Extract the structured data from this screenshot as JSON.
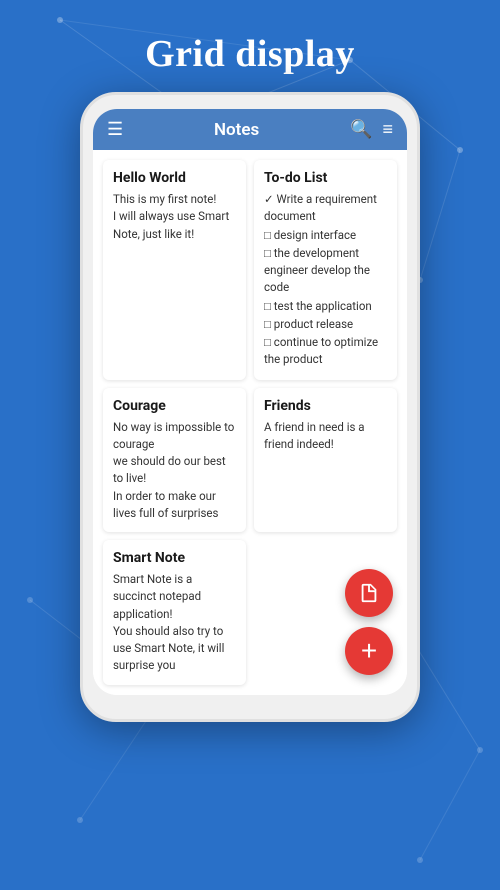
{
  "page": {
    "title": "Grid display"
  },
  "topbar": {
    "title": "Notes",
    "menu_icon": "☰",
    "search_icon": "🔍",
    "filter_icon": "≡"
  },
  "notes": [
    {
      "id": "hello-world",
      "title": "Hello World",
      "body": "This is my first note!\nI will always use Smart Note, just like it!"
    },
    {
      "id": "to-do-list",
      "title": "To-do List",
      "type": "todo",
      "items": [
        {
          "check": "✓",
          "text": "Write a requirement document"
        },
        {
          "check": "□",
          "text": "design interface"
        },
        {
          "check": "□",
          "text": "the development engineer develop the code"
        },
        {
          "check": "□",
          "text": "test the application"
        },
        {
          "check": "□",
          "text": "product release"
        },
        {
          "check": "□",
          "text": "continue to optimize the product"
        }
      ]
    },
    {
      "id": "courage",
      "title": "Courage",
      "body": "No way is impossible to courage\nwe should do our best to live!\nIn order to make our lives full of surprises"
    },
    {
      "id": "friends",
      "title": "Friends",
      "body": "A friend in need is a friend indeed!"
    },
    {
      "id": "smart-note",
      "title": "Smart Note",
      "body": "Smart Note is a succinct notepad application!\nYou should also try to use Smart Note, it will surprise you"
    }
  ],
  "fabs": [
    {
      "icon": "📄",
      "label": "new-note-fab"
    },
    {
      "icon": "+",
      "label": "add-fab"
    }
  ]
}
